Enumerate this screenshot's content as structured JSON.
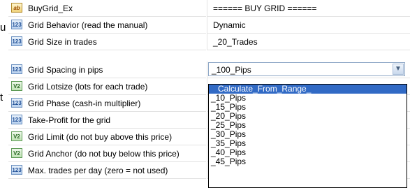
{
  "background_fragments": [
    "u",
    "t"
  ],
  "properties": [
    {
      "type": "string",
      "icon": "ab",
      "name": "BuyGrid_Ex",
      "value": "====== BUY GRID ======"
    },
    {
      "type": "integer",
      "icon": "123",
      "name": "Grid Behavior (read the manual)",
      "value": "Dynamic"
    },
    {
      "type": "integer",
      "icon": "123",
      "name": "Grid Size in trades",
      "value": "_20_Trades"
    },
    {
      "type": "integer",
      "icon": "123",
      "name": "Grid Spacing in pips",
      "value": "_100_Pips"
    },
    {
      "type": "double",
      "icon": "V2",
      "name": "Grid Lotsize (lots for each trade)",
      "value": ""
    },
    {
      "type": "integer",
      "icon": "123",
      "name": "Grid Phase (cash-in multiplier)",
      "value": ""
    },
    {
      "type": "integer",
      "icon": "123",
      "name": "Take-Profit for the grid",
      "value": ""
    },
    {
      "type": "double",
      "icon": "V2",
      "name": "Grid Limit (do not buy above this price)",
      "value": ""
    },
    {
      "type": "double",
      "icon": "V2",
      "name": "Grid Anchor (do not buy below this price)",
      "value": ""
    },
    {
      "type": "integer",
      "icon": "123",
      "name": "Max. trades per day (zero = not used)",
      "value": ""
    }
  ],
  "dropdown": {
    "selected": "Calculate_From_Range_",
    "options": [
      "Calculate_From_Range_",
      "_10_Pips",
      "_15_Pips",
      "_20_Pips",
      "_25_Pips",
      "_30_Pips",
      "_35_Pips",
      "_40_Pips",
      "_45_Pips"
    ]
  }
}
